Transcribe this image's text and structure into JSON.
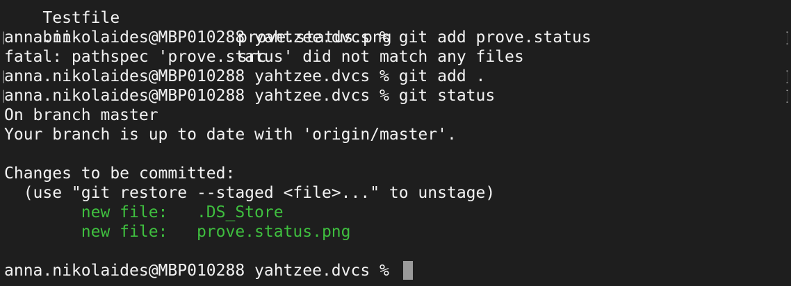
{
  "terminal": {
    "partial_top_row": {
      "col1": "Testfile",
      "col2": "prove.status.png"
    },
    "ls_row": {
      "col1": "bin",
      "col2": "src"
    },
    "lines": [
      "anna.nikolaides@MBP010288 yahtzee.dvcs % git add prove.status",
      "fatal: pathspec 'prove.status' did not match any files",
      "anna.nikolaides@MBP010288 yahtzee.dvcs % git add .",
      "anna.nikolaides@MBP010288 yahtzee.dvcs % git status",
      "On branch master",
      "Your branch is up to date with 'origin/master'.",
      "",
      "Changes to be committed:",
      "  (use \"git restore --staged <file>...\" to unstage)",
      "        new file:   .DS_Store",
      "        new file:   prove.status.png",
      "",
      "anna.nikolaides@MBP010288 yahtzee.dvcs % "
    ],
    "bracket_left": "[",
    "bracket_right": "]",
    "colors": {
      "background": "#1e1e1e",
      "text": "#f2f2f2",
      "staged": "#3fbf3f",
      "cursor": "#9a9a9a"
    }
  }
}
